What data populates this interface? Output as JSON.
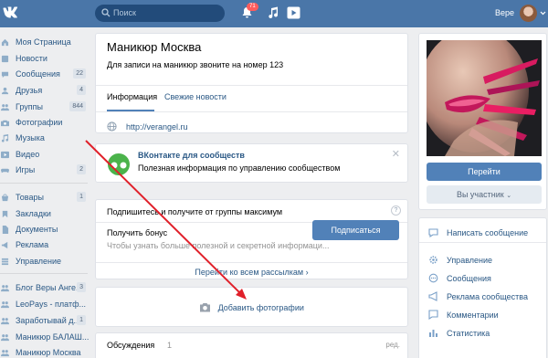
{
  "header": {
    "search_placeholder": "Поиск",
    "notifications_count": "71",
    "user_name": "Вере"
  },
  "sidebar": {
    "items": [
      {
        "label": "Моя Страница",
        "count": "",
        "icon": "home-icon"
      },
      {
        "label": "Новости",
        "count": "",
        "icon": "news-icon"
      },
      {
        "label": "Сообщения",
        "count": "22",
        "icon": "message-icon"
      },
      {
        "label": "Друзья",
        "count": "4",
        "icon": "friends-icon"
      },
      {
        "label": "Группы",
        "count": "844",
        "icon": "groups-icon"
      },
      {
        "label": "Фотографии",
        "count": "",
        "icon": "camera-icon"
      },
      {
        "label": "Музыка",
        "count": "",
        "icon": "music-icon"
      },
      {
        "label": "Видео",
        "count": "",
        "icon": "video-icon"
      },
      {
        "label": "Игры",
        "count": "2",
        "icon": "games-icon"
      },
      {
        "label": "Товары",
        "count": "1",
        "icon": "goods-icon"
      },
      {
        "label": "Закладки",
        "count": "",
        "icon": "bookmark-icon"
      },
      {
        "label": "Документы",
        "count": "",
        "icon": "document-icon"
      },
      {
        "label": "Реклама",
        "count": "",
        "icon": "ads-icon"
      },
      {
        "label": "Управление",
        "count": "",
        "icon": "manage-icon"
      },
      {
        "label": "Блог Веры Анге...",
        "count": "3",
        "icon": "group-icon"
      },
      {
        "label": "LeoPays - платф...",
        "count": "",
        "icon": "group-icon"
      },
      {
        "label": "Заработывай д...",
        "count": "1",
        "icon": "group-icon"
      },
      {
        "label": "Маникюр БАЛАШ...",
        "count": "",
        "icon": "group-icon"
      },
      {
        "label": "Маникюр Москва",
        "count": "",
        "icon": "group-icon"
      }
    ]
  },
  "group": {
    "title": "Маникюр Москва",
    "status": "Для записи на маникюр звоните на номер 123",
    "tabs": [
      {
        "label": "Информация",
        "active": true
      },
      {
        "label": "Свежие новости",
        "active": false
      }
    ],
    "website": "http://verangel.ru"
  },
  "promo": {
    "title": "ВКонтакте для сообществ",
    "text": "Полезная информация по управлению сообществом"
  },
  "subscribe": {
    "heading": "Подпишитесь и получите от группы максимум",
    "help": "?",
    "bonus_title": "Получить бонус",
    "bonus_text": "Чтобы узнать больше полезной и секретной информаци...",
    "button": "Подписаться",
    "footer_link": "Перейти ко всем рассылкам"
  },
  "photos": {
    "add_label": "Добавить фотографии"
  },
  "discussions": {
    "label": "Обсуждения",
    "count": "1",
    "edit": "ред."
  },
  "right": {
    "go_button": "Перейти",
    "member_button": "Вы участник",
    "menu": [
      {
        "label": "Написать сообщение",
        "icon": "message-icon"
      },
      {
        "label": "Управление",
        "icon": "gear-icon"
      },
      {
        "label": "Сообщения",
        "icon": "chat-icon"
      },
      {
        "label": "Реклама сообщества",
        "icon": "megaphone-icon"
      },
      {
        "label": "Комментарии",
        "icon": "comment-icon"
      },
      {
        "label": "Статистика",
        "icon": "stats-icon"
      }
    ]
  },
  "colors": {
    "header": "#4a76a8",
    "accent": "#5181b8",
    "link": "#2a5885",
    "arrow": "#e0202a"
  }
}
